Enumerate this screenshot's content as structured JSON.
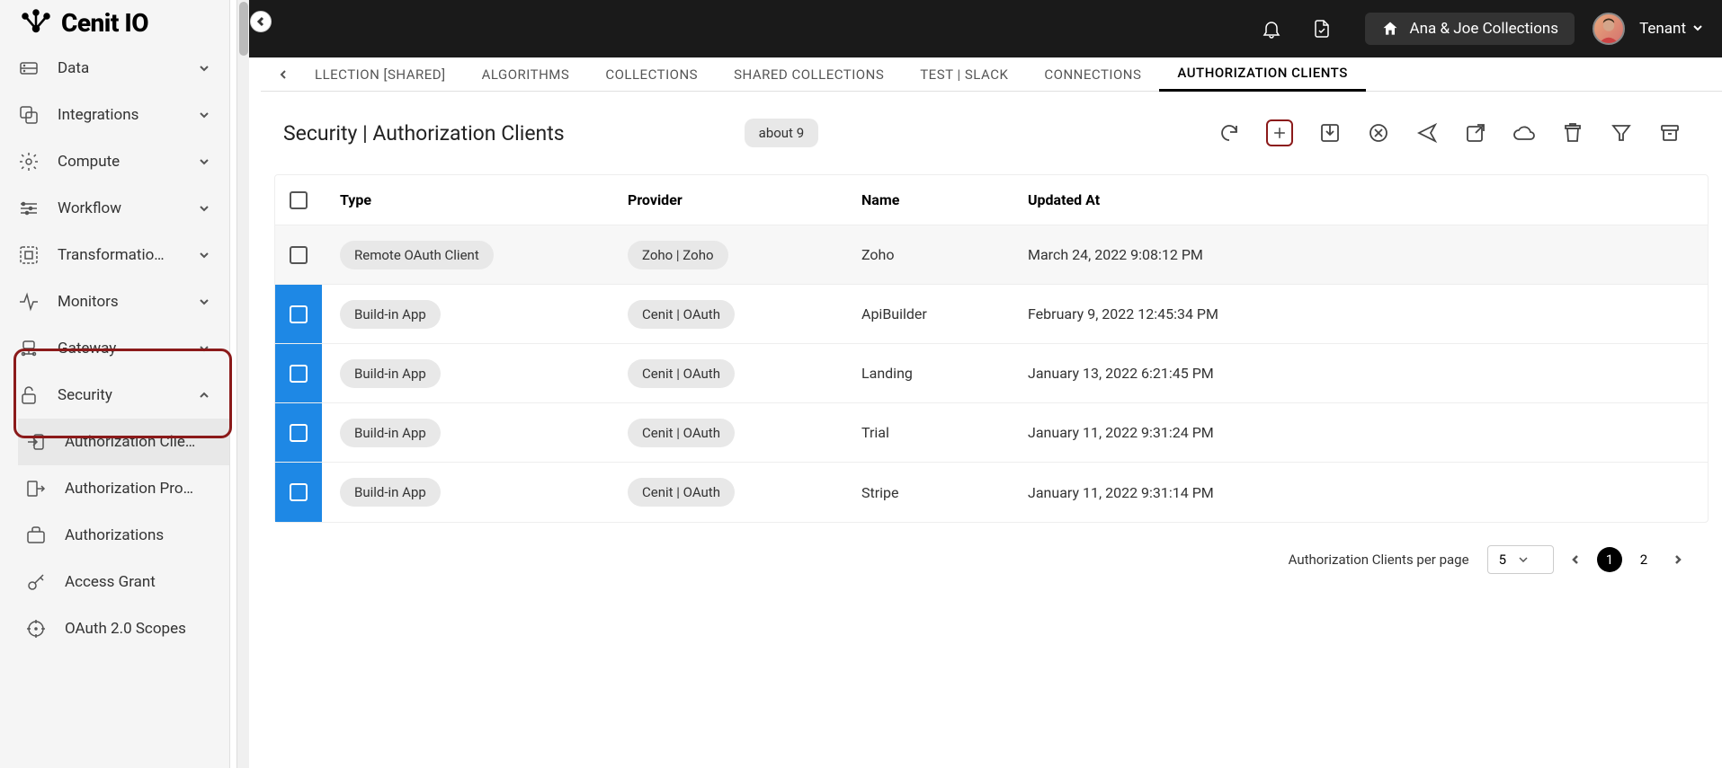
{
  "app": {
    "name": "Cenit IO"
  },
  "header": {
    "tenant_name": "Ana & Joe Collections",
    "tenant_label": "Tenant"
  },
  "sidebar": {
    "items": [
      {
        "label": "Data",
        "icon": "database",
        "expanded": false
      },
      {
        "label": "Integrations",
        "icon": "layers",
        "expanded": false
      },
      {
        "label": "Compute",
        "icon": "gear",
        "expanded": false
      },
      {
        "label": "Workflow",
        "icon": "flow",
        "expanded": false
      },
      {
        "label": "Transformatio…",
        "icon": "transform",
        "expanded": false
      },
      {
        "label": "Monitors",
        "icon": "activity",
        "expanded": false
      },
      {
        "label": "Gateway",
        "icon": "gateway",
        "expanded": false
      },
      {
        "label": "Security",
        "icon": "lock",
        "expanded": true,
        "children": [
          {
            "label": "Authorization Clie…",
            "icon": "login",
            "active": true
          },
          {
            "label": "Authorization Pro…",
            "icon": "exit"
          },
          {
            "label": "Authorizations",
            "icon": "briefcase"
          },
          {
            "label": "Access Grant",
            "icon": "key"
          },
          {
            "label": "OAuth 2.0 Scopes",
            "icon": "target"
          }
        ]
      }
    ]
  },
  "tabs": [
    {
      "label": "LLECTION [SHARED]"
    },
    {
      "label": "ALGORITHMS"
    },
    {
      "label": "COLLECTIONS"
    },
    {
      "label": "SHARED COLLECTIONS"
    },
    {
      "label": "TEST | SLACK"
    },
    {
      "label": "CONNECTIONS"
    },
    {
      "label": "AUTHORIZATION CLIENTS",
      "active": true
    }
  ],
  "page": {
    "title": "Security | Authorization Clients",
    "count_badge": "about 9"
  },
  "table": {
    "columns": [
      "Type",
      "Provider",
      "Name",
      "Updated At"
    ],
    "rows": [
      {
        "selected": false,
        "type": "Remote OAuth Client",
        "provider": "Zoho | Zoho",
        "name": "Zoho",
        "updated": "March 24, 2022 9:08:12 PM"
      },
      {
        "selected": true,
        "type": "Build-in App",
        "provider": "Cenit | OAuth",
        "name": "ApiBuilder",
        "updated": "February 9, 2022 12:45:34 PM"
      },
      {
        "selected": true,
        "type": "Build-in App",
        "provider": "Cenit | OAuth",
        "name": "Landing",
        "updated": "January 13, 2022 6:21:45 PM"
      },
      {
        "selected": true,
        "type": "Build-in App",
        "provider": "Cenit | OAuth",
        "name": "Trial",
        "updated": "January 11, 2022 9:31:24 PM"
      },
      {
        "selected": true,
        "type": "Build-in App",
        "provider": "Cenit | OAuth",
        "name": "Stripe",
        "updated": "January 11, 2022 9:31:14 PM"
      }
    ]
  },
  "pagination": {
    "per_page_label": "Authorization Clients per page",
    "per_page_value": "5",
    "current_page": "1",
    "next_page": "2"
  }
}
